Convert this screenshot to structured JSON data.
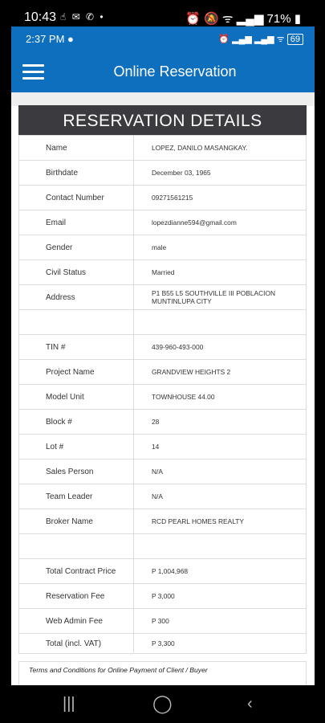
{
  "outer_status": {
    "time": "10:43",
    "battery": "71%"
  },
  "inner_status": {
    "time": "2:37 PM",
    "battery": "69"
  },
  "appbar": {
    "title": "Online Reservation"
  },
  "card": {
    "heading": "RESERVATION DETAILS"
  },
  "rows": [
    {
      "label": "Name",
      "value": "LOPEZ, DANILO MASANGKAY."
    },
    {
      "label": "Birthdate",
      "value": "December 03, 1965"
    },
    {
      "label": "Contact Number",
      "value": "09271561215"
    },
    {
      "label": "Email",
      "value": "lopezdianne594@gmail.com"
    },
    {
      "label": "Gender",
      "value": "male"
    },
    {
      "label": "Civil Status",
      "value": "Married"
    },
    {
      "label": "Address",
      "value": "P1 B55 L5 SOUTHVILLE III POBLACION MUNTINLUPA CITY"
    },
    {
      "label": "",
      "value": ""
    },
    {
      "label": "TIN #",
      "value": "439-960-493-000"
    },
    {
      "label": "Project Name",
      "value": "GRANDVIEW HEIGHTS 2"
    },
    {
      "label": "Model Unit",
      "value": "TOWNHOUSE 44.00"
    },
    {
      "label": "Block #",
      "value": "28"
    },
    {
      "label": "Lot #",
      "value": "14"
    },
    {
      "label": "Sales Person",
      "value": "N/A"
    },
    {
      "label": "Team Leader",
      "value": "N/A"
    },
    {
      "label": "Broker Name",
      "value": "RCD PEARL HOMES REALTY"
    },
    {
      "label": "",
      "value": ""
    },
    {
      "label": "Total Contract Price",
      "value": "P 1,004,968"
    },
    {
      "label": "Reservation Fee",
      "value": "P 3,000"
    },
    {
      "label": "Web Admin Fee",
      "value": "P 300"
    },
    {
      "label": "Total (incl. VAT)",
      "value": "P 3,300"
    }
  ],
  "terms": {
    "text": "Terms and Conditions for Online Payment of Client / Buyer"
  },
  "icons": {
    "menu": "hamburger-icon",
    "recents": "recents-icon",
    "home": "home-icon",
    "back": "back-icon"
  }
}
